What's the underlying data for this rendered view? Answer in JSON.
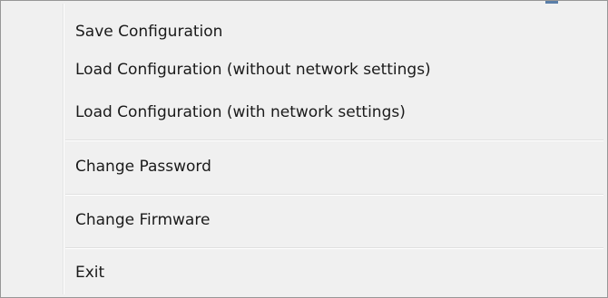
{
  "menu": {
    "items": [
      {
        "label": "Save Configuration"
      },
      {
        "label": "Load Configuration (without network settings)"
      },
      {
        "label": "Load Configuration (with network settings)"
      },
      {
        "label": "Change Password"
      },
      {
        "label": "Change Firmware"
      },
      {
        "label": "Exit"
      }
    ]
  },
  "colors": {
    "menu_background": "#f0f0f0",
    "menu_border": "#979797",
    "separator": "#e0e0e0",
    "text": "#1a1a1a"
  }
}
